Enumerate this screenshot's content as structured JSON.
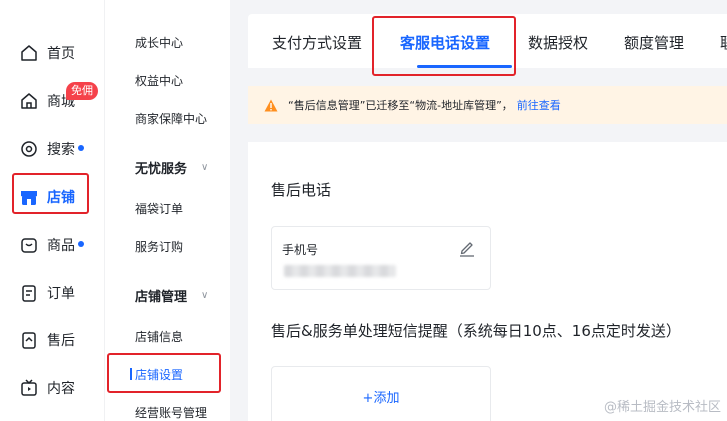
{
  "left_nav": {
    "items": [
      {
        "label": "首页",
        "icon": "home-icon",
        "dot": false
      },
      {
        "label": "商城",
        "icon": "shop-icon",
        "dot": false
      },
      {
        "label": "搜索",
        "icon": "search-icon",
        "dot": true
      },
      {
        "label": "店铺",
        "icon": "store-icon",
        "dot": false,
        "active": true
      },
      {
        "label": "商品",
        "icon": "product-icon",
        "dot": true
      },
      {
        "label": "订单",
        "icon": "order-icon",
        "dot": false
      },
      {
        "label": "售后",
        "icon": "after-sales-icon",
        "dot": false
      },
      {
        "label": "内容",
        "icon": "content-icon",
        "dot": false
      }
    ],
    "badge": "免佣"
  },
  "sub_nav": {
    "items": [
      "成长中心",
      "权益中心",
      "商家保障中心"
    ],
    "group1": {
      "title": "无忧服务",
      "items": [
        "福袋订单",
        "服务订购"
      ]
    },
    "group2": {
      "title": "店铺管理",
      "items": [
        "店铺信息",
        "店铺设置",
        "经营账号管理"
      ]
    }
  },
  "tabs": [
    "支付方式设置",
    "客服电话设置",
    "数据授权",
    "额度管理",
    "联"
  ],
  "notice": {
    "text": "“售后信息管理”已迁移至“物流-地址库管理”，",
    "link": "前往查看"
  },
  "content": {
    "section1_title": "售后电话",
    "phone_label": "手机号",
    "section2_title": "售后&服务单处理短信提醒（系统每日10点、16点定时发送）",
    "add_label": "+添加"
  },
  "watermark": "@稀土掘金技术社区",
  "colors": {
    "accent": "#1966ff",
    "highlight": "#e2232a",
    "warning": "#ff8f1f"
  }
}
